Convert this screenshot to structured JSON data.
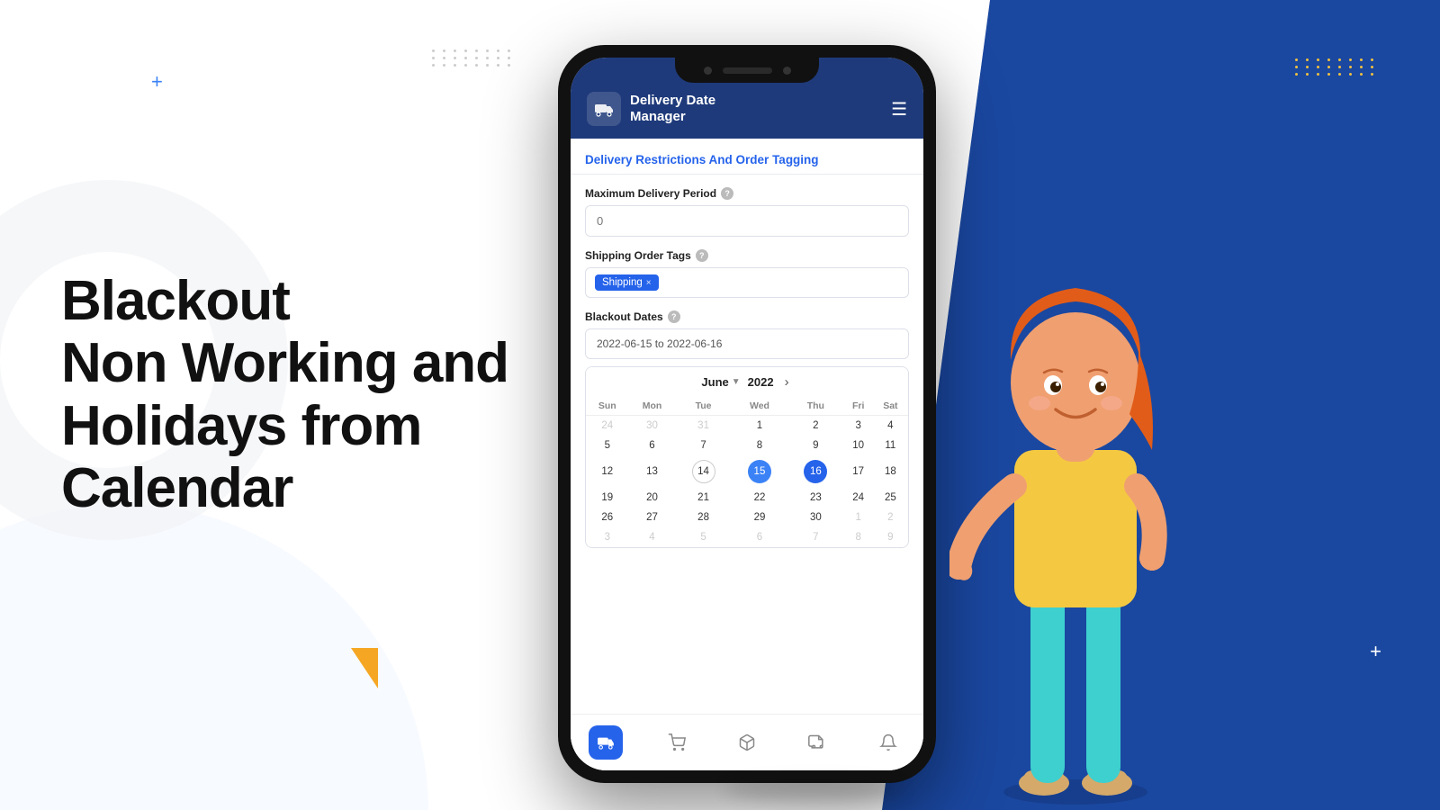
{
  "page": {
    "bg_right_color": "#1a47a0",
    "hero": {
      "line1": "Blackout",
      "line2": "Non Working and",
      "line3": "Holidays from",
      "line4": "Calendar"
    },
    "app": {
      "title_line1": "Delivery Date",
      "title_line2": "Manager",
      "section_title": "Delivery Restrictions And Order Tagging",
      "fields": {
        "max_delivery_label": "Maximum Delivery Period",
        "max_delivery_placeholder": "0",
        "shipping_tags_label": "Shipping Order Tags",
        "tag_value": "Shipping",
        "blackout_dates_label": "Blackout Dates",
        "date_range_value": "2022-06-15 to 2022-06-16"
      },
      "calendar": {
        "month": "June",
        "year": "2022",
        "day_headers": [
          "Sun",
          "Mon",
          "Tue",
          "Wed",
          "Thu",
          "Fri",
          "Sat"
        ],
        "weeks": [
          [
            "24",
            "30",
            "31",
            "1",
            "2",
            "3",
            "4"
          ],
          [
            "5",
            "6",
            "7",
            "8",
            "9",
            "10",
            "11"
          ],
          [
            "12",
            "13",
            "14",
            "15",
            "16",
            "17",
            "18"
          ],
          [
            "19",
            "20",
            "21",
            "22",
            "23",
            "24",
            "25"
          ],
          [
            "26",
            "27",
            "28",
            "29",
            "30",
            "1",
            "2"
          ],
          [
            "3",
            "4",
            "5",
            "6",
            "7",
            "8",
            "9"
          ]
        ],
        "selected_start": "15",
        "selected_end": "16",
        "circled": "14"
      },
      "bottom_nav": {
        "items": [
          "🚚",
          "🛒",
          "📦",
          "🚗",
          "🔔"
        ]
      }
    },
    "decorations": {
      "plus_blue_color": "#3b82f6",
      "triangle_orange": "#f5a623",
      "dot_color_top": "#ccc",
      "dot_color_right": "#f0c040",
      "plus_white_color": "#fff"
    }
  }
}
